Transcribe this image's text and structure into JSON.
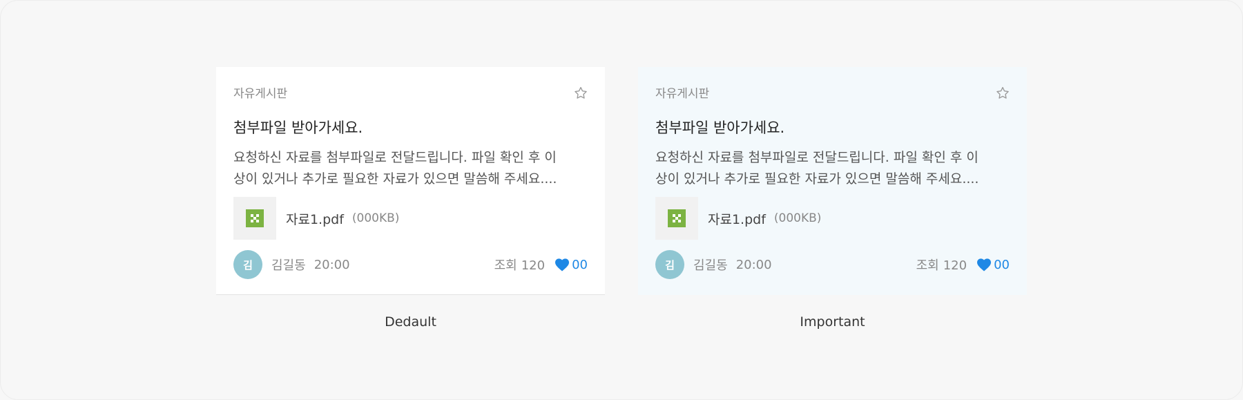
{
  "cards": [
    {
      "board": "자유게시판",
      "title": "첨부파일 받아가세요.",
      "excerpt_line1": "요청하신 자료를 첨부파일로 전달드립니다. 파일 확인 후 이",
      "excerpt_line2": "상이 있거나 추가로 필요한 자료가 있으면 말씀해 주세요....",
      "file_name": "자료1.pdf",
      "file_size": "(000KB)",
      "avatar_initial": "김",
      "author": "김길동",
      "time": "20:00",
      "views_label": "조회",
      "views": "120",
      "likes": "00",
      "caption": "Dedault",
      "background": "#ffffff"
    },
    {
      "board": "자유게시판",
      "title": "첨부파일 받아가세요.",
      "excerpt_line1": "요청하신 자료를 첨부파일로 전달드립니다. 파일 확인 후 이",
      "excerpt_line2": "상이 있거나 추가로 필요한 자료가 있으면 말씀해 주세요....",
      "file_name": "자료1.pdf",
      "file_size": "(000KB)",
      "avatar_initial": "김",
      "author": "김길동",
      "time": "20:00",
      "views_label": "조회",
      "views": "120",
      "likes": "00",
      "caption": "Important",
      "background": "#f3f9fc"
    }
  ],
  "icons": {
    "bookmark": "star-icon",
    "file": "excel-file-icon",
    "like": "heart-icon"
  },
  "colors": {
    "accent": "#1e88e5",
    "avatar": "#8fc6d2",
    "file_icon": "#7cb342"
  }
}
